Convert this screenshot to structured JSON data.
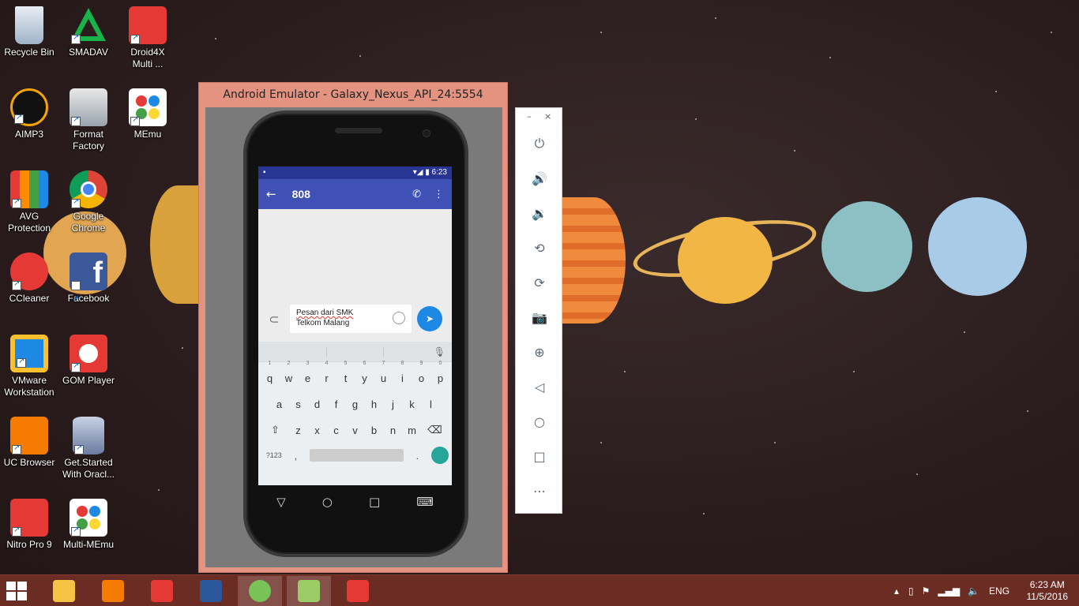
{
  "desktop": {
    "icons": [
      {
        "label": "Recycle Bin",
        "icon": "recycle-bin-icon"
      },
      {
        "label": "SMADAV",
        "icon": "smadav-icon"
      },
      {
        "label": "Droid4X Multi ...",
        "icon": "droid4x-icon"
      },
      {
        "label": "AIMP3",
        "icon": "aimp3-icon"
      },
      {
        "label": "Format Factory",
        "icon": "format-factory-icon"
      },
      {
        "label": "MEmu",
        "icon": "memu-icon"
      },
      {
        "label": "AVG Protection",
        "icon": "avg-icon"
      },
      {
        "label": "Google Chrome",
        "icon": "chrome-icon"
      },
      {
        "label": "CCleaner",
        "icon": "ccleaner-icon"
      },
      {
        "label": "Facebook",
        "icon": "facebook-icon"
      },
      {
        "label": "VMware Workstation",
        "icon": "vmware-icon"
      },
      {
        "label": "GOM Player",
        "icon": "gom-player-icon"
      },
      {
        "label": "UC Browser",
        "icon": "uc-browser-icon"
      },
      {
        "label": "Get.Started With Oracl...",
        "icon": "oracle-icon"
      },
      {
        "label": "Nitro Pro 9",
        "icon": "nitro-pro-icon"
      },
      {
        "label": "Multi-MEmu",
        "icon": "multi-memu-icon"
      }
    ]
  },
  "emulator": {
    "window_title": "Android Emulator - Galaxy_Nexus_API_24:5554",
    "status_time": "6:23",
    "conversation_title": "808",
    "message_line1": "Pesan dari SMK",
    "message_line2": "Telkom Malang",
    "keyboard": {
      "row1": [
        "q",
        "w",
        "e",
        "r",
        "t",
        "y",
        "u",
        "i",
        "o",
        "p"
      ],
      "row1_nums": [
        "1",
        "2",
        "3",
        "4",
        "5",
        "6",
        "7",
        "8",
        "9",
        "0"
      ],
      "row2": [
        "a",
        "s",
        "d",
        "f",
        "g",
        "h",
        "j",
        "k",
        "l"
      ],
      "row3": [
        "z",
        "x",
        "c",
        "v",
        "b",
        "n",
        "m"
      ],
      "symbols_key": "?123",
      "comma_key": ",",
      "period_key": "."
    }
  },
  "toolbar": {
    "minimize": "–",
    "close": "×"
  },
  "taskbar": {
    "language": "ENG",
    "time": "6:23 AM",
    "date": "11/5/2016"
  }
}
